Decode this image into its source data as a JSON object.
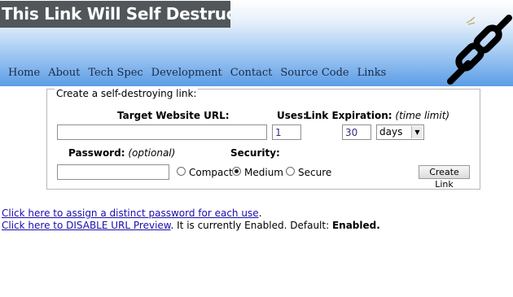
{
  "header": {
    "title": "This Link Will Self Destruct",
    "nav": [
      "Home",
      "About",
      "Tech Spec",
      "Development",
      "Contact",
      "Source Code",
      "Links"
    ]
  },
  "form": {
    "legend": "Create a self-destroying link:",
    "url_label": "Target Website URL:",
    "url_value": "",
    "uses_label": "Uses:",
    "uses_value": "1",
    "expiration_label": "Link Expiration:",
    "expiration_hint": "(time limit)",
    "expiration_value": "30",
    "expiration_unit": "days",
    "password_label": "Password:",
    "password_hint": "(optional)",
    "password_value": "",
    "security_label": "Security:",
    "security_options": [
      "Compact",
      "Medium",
      "Secure"
    ],
    "security_selected": "Medium",
    "create_button": "Create Link"
  },
  "footer": {
    "distinct_password_link": "Click here to assign a distinct password for each use",
    "distinct_password_after": ".",
    "disable_preview_link": "Click here to DISABLE URL Preview",
    "preview_status_text": ". It is currently Enabled. Default: ",
    "preview_default": "Enabled."
  },
  "colors": {
    "title_background": "#50565a",
    "header_gradient_bottom": "#5b9de6",
    "link": "#1a0dab"
  }
}
